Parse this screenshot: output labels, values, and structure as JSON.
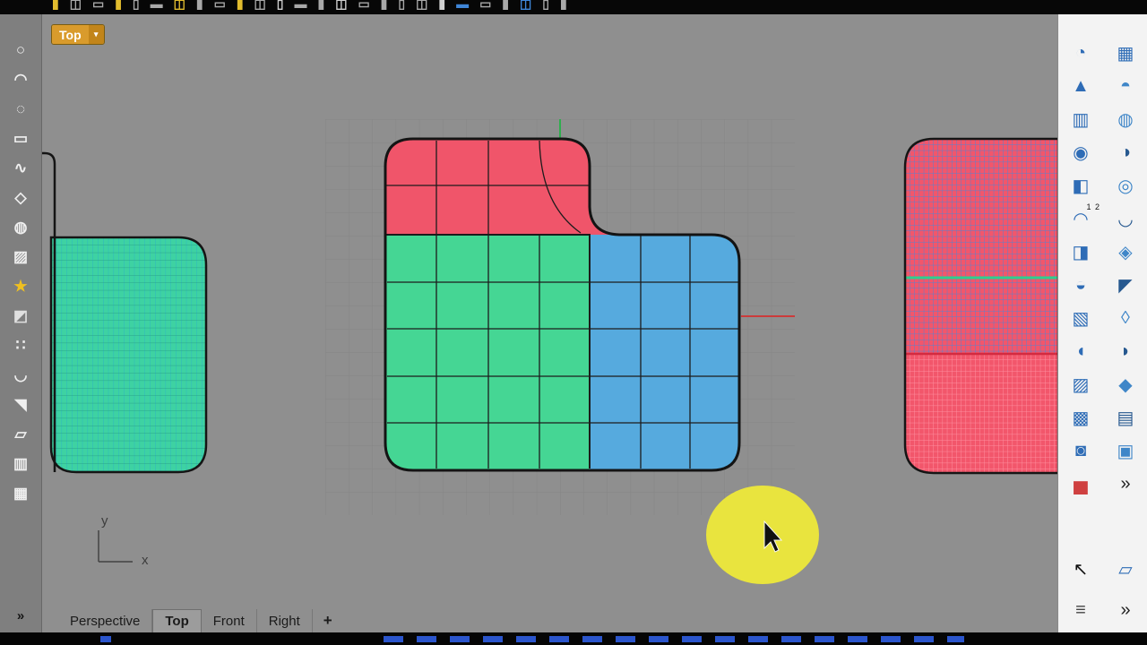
{
  "window": {
    "viewport_label": "Top",
    "menu_arrow": "▾"
  },
  "colors": {
    "vp_bg": "#8f8f8f",
    "grid_line": "#858585",
    "shape_red": "#f0556a",
    "shape_green": "#45d694",
    "shape_blue": "#56aade",
    "teal_fill": "#3ed2a2",
    "teal_grid_v": "#2cb2c6",
    "teal_grid_h": "#27a089",
    "right_fill": "#f2566b",
    "right_grid_blue": "#4d85d6",
    "right_grid_pink": "#ff92a2",
    "right_green_line": "#2ecf8e",
    "right_red_line": "#d42a40",
    "axis_red": "#cc3b3b",
    "axis_green": "#2fae4e",
    "highlight": "#e9e43e",
    "gizmo": "#424242"
  },
  "top_toolbar": {
    "icons": [
      {
        "g": "▮",
        "c": "#e2bc2e"
      },
      {
        "g": "◫",
        "c": "#a8a8a8"
      },
      {
        "g": "▭",
        "c": "#a8a8a8"
      },
      {
        "g": "▮",
        "c": "#e2bc2e"
      },
      {
        "g": "▯",
        "c": "#a8a8a8"
      },
      {
        "g": "▬",
        "c": "#a8a8a8"
      },
      {
        "g": "◫",
        "c": "#e2bc2e"
      },
      {
        "g": "▮",
        "c": "#a8a8a8"
      },
      {
        "g": "▭",
        "c": "#a8a8a8"
      },
      {
        "g": "▮",
        "c": "#e2bc2e"
      },
      {
        "g": "◫",
        "c": "#a8a8a8"
      },
      {
        "g": "▯",
        "c": "#d0d0d0"
      },
      {
        "g": "▬",
        "c": "#a8a8a8"
      },
      {
        "g": "▮",
        "c": "#a8a8a8"
      },
      {
        "g": "◫",
        "c": "#d0d0d0"
      },
      {
        "g": "▭",
        "c": "#a8a8a8"
      },
      {
        "g": "▮",
        "c": "#a8a8a8"
      },
      {
        "g": "▯",
        "c": "#a8a8a8"
      },
      {
        "g": "◫",
        "c": "#a8a8a8"
      },
      {
        "g": "▮",
        "c": "#d0d0d0"
      },
      {
        "g": "▬",
        "c": "#3f86d8"
      },
      {
        "g": "▭",
        "c": "#a8a8a8"
      },
      {
        "g": "▮",
        "c": "#a8a8a8"
      },
      {
        "g": "◫",
        "c": "#3f86d8"
      },
      {
        "g": "▯",
        "c": "#a8a8a8"
      },
      {
        "g": "▮",
        "c": "#a8a8a8"
      }
    ]
  },
  "left_toolbar": {
    "icons": [
      {
        "g": "○",
        "name": "ellipse-tool-icon"
      },
      {
        "g": "◠",
        "name": "arc-tool-icon"
      },
      {
        "g": "◌",
        "name": "circle-tool-icon"
      },
      {
        "g": "▭",
        "name": "rectangle-tool-icon"
      },
      {
        "g": "∿",
        "name": "curve-tool-icon"
      },
      {
        "g": "◇",
        "name": "polygon-tool-icon"
      },
      {
        "g": "◍",
        "name": "surface-tool-icon"
      },
      {
        "g": "▨",
        "name": "mesh-tool-icon"
      },
      {
        "g": "★",
        "name": "render-tool-icon",
        "color": "#f0c020"
      },
      {
        "g": "◩",
        "name": "shade-tool-icon",
        "color": "#e0e0e0"
      },
      {
        "g": "∷",
        "name": "point-tool-icon"
      },
      {
        "g": "◡",
        "name": "blend-tool-icon"
      },
      {
        "g": "◥",
        "name": "fillet-tool-icon"
      },
      {
        "g": "▱",
        "name": "plane-tool-icon"
      },
      {
        "g": "▥",
        "name": "array-tool-icon"
      },
      {
        "g": "▦",
        "name": "grid-tool-icon"
      }
    ],
    "more": "»"
  },
  "right_panel": {
    "icons": [
      {
        "g": "◔",
        "name": "sphere-icon"
      },
      {
        "g": "▦",
        "name": "plane-grid-icon"
      },
      {
        "g": "▲",
        "name": "cone-icon"
      },
      {
        "g": "◓",
        "name": "dome-icon",
        "color": "#3f86c8"
      },
      {
        "g": "▥",
        "name": "cylinder-icon"
      },
      {
        "g": "◍",
        "name": "ellipsoid-icon",
        "color": "#3f86c8"
      },
      {
        "g": "◉",
        "name": "sphere-uv-icon"
      },
      {
        "g": "◑",
        "name": "hemisphere-icon",
        "color": "#26588f"
      },
      {
        "g": "◧",
        "name": "box-icon"
      },
      {
        "g": "◎",
        "name": "pipe-icon",
        "color": "#3f86c8"
      },
      {
        "g": "◠",
        "name": "blend-curve-icon",
        "sub": "1 2"
      },
      {
        "g": "◡",
        "name": "adjustable-blend-icon",
        "color": "#26588f"
      },
      {
        "g": "◨",
        "name": "ribbon-icon"
      },
      {
        "g": "◈",
        "name": "branch-icon",
        "color": "#3f86c8"
      },
      {
        "g": "◒",
        "name": "patch-icon"
      },
      {
        "g": "◤",
        "name": "corner-blend-icon",
        "color": "#26588f"
      },
      {
        "g": "▧",
        "name": "mesh-box-icon"
      },
      {
        "g": "◊",
        "name": "drape-icon",
        "color": "#3f86c8"
      },
      {
        "g": "◖",
        "name": "node-edit-icon"
      },
      {
        "g": "◗",
        "name": "split-icon",
        "color": "#26588f"
      },
      {
        "g": "▨",
        "name": "mesh-cube-icon"
      },
      {
        "g": "◆",
        "name": "hex-block-icon",
        "color": "#3f86c8"
      },
      {
        "g": "▩",
        "name": "mesh-panel-icon"
      },
      {
        "g": "▤",
        "name": "offset-mesh-icon",
        "color": "#26588f"
      },
      {
        "g": "◙",
        "name": "mesh-sphere-icon"
      },
      {
        "g": "▣",
        "name": "bounding-box-icon",
        "color": "#3f86c8"
      },
      {
        "g": "▅",
        "name": "analysis-bars-icon",
        "color": "#cf4040"
      },
      {
        "g": "»",
        "name": "more-tools-chevron-icon",
        "color": "#222222"
      }
    ],
    "footer_icons": [
      {
        "g": "↖",
        "name": "pointer-icon",
        "color": "#101010"
      },
      {
        "g": "▱",
        "name": "surface-icon"
      },
      {
        "g": "≡",
        "name": "layers-icon",
        "color": "#444444"
      },
      {
        "g": "»",
        "name": "panel-more-chevron-icon",
        "color": "#222222"
      }
    ]
  },
  "tabs": {
    "items": [
      {
        "label": "Perspective",
        "name": "tab-perspective"
      },
      {
        "label": "Top",
        "name": "tab-top",
        "active": true
      },
      {
        "label": "Front",
        "name": "tab-front"
      },
      {
        "label": "Right",
        "name": "tab-right"
      }
    ],
    "add_label": "+"
  },
  "axis_indicator": {
    "x": "x",
    "y": "y"
  }
}
